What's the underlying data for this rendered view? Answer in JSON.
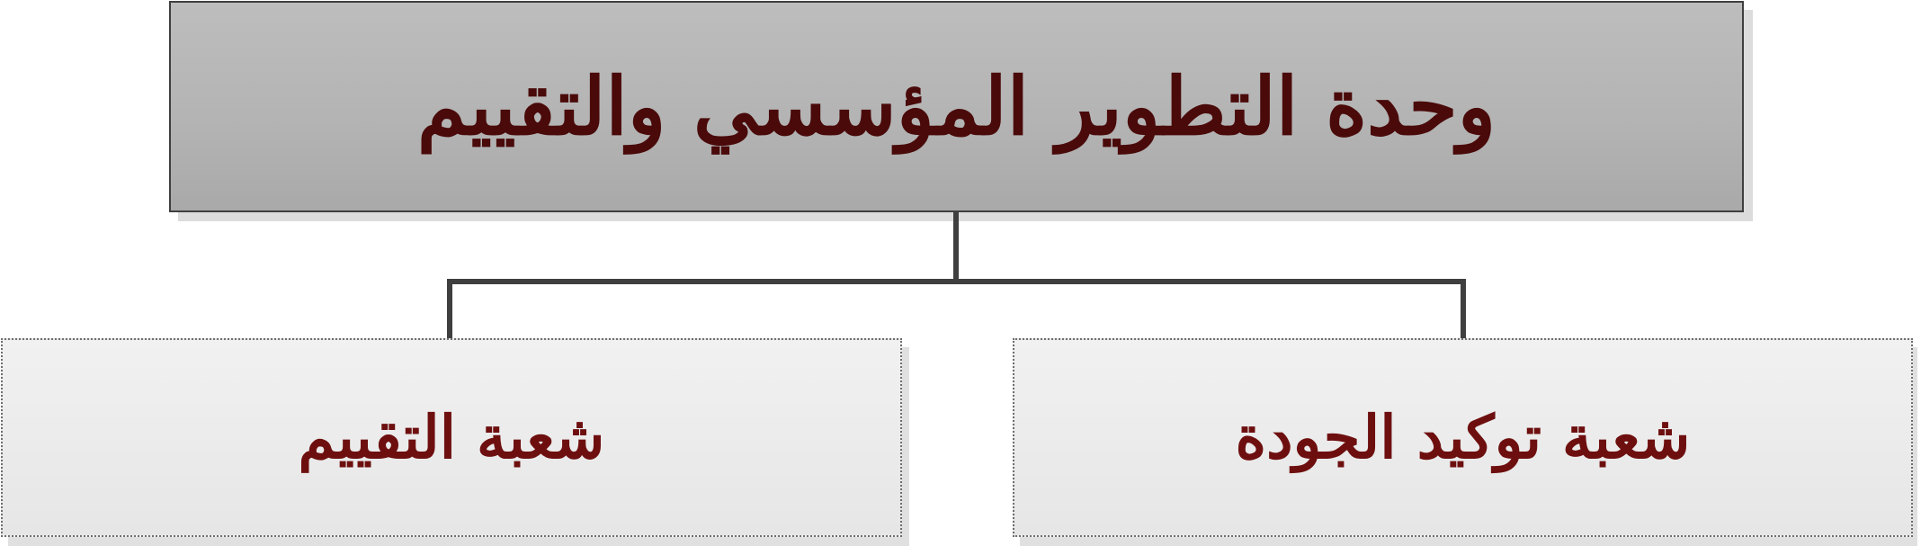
{
  "diagram": {
    "type": "org-chart",
    "root": {
      "label": "وحدة التطوير المؤسسي والتقييم"
    },
    "children": [
      {
        "label": "شعبة توكيد الجودة"
      },
      {
        "label": "شعبة التقييم"
      }
    ],
    "colors": {
      "root_fill": "#b3b3b3",
      "child_fill": "#e9e9e9",
      "root_text": "#4a0a0a",
      "child_text": "#6e0f0f",
      "connector": "#3f3f3f"
    }
  }
}
